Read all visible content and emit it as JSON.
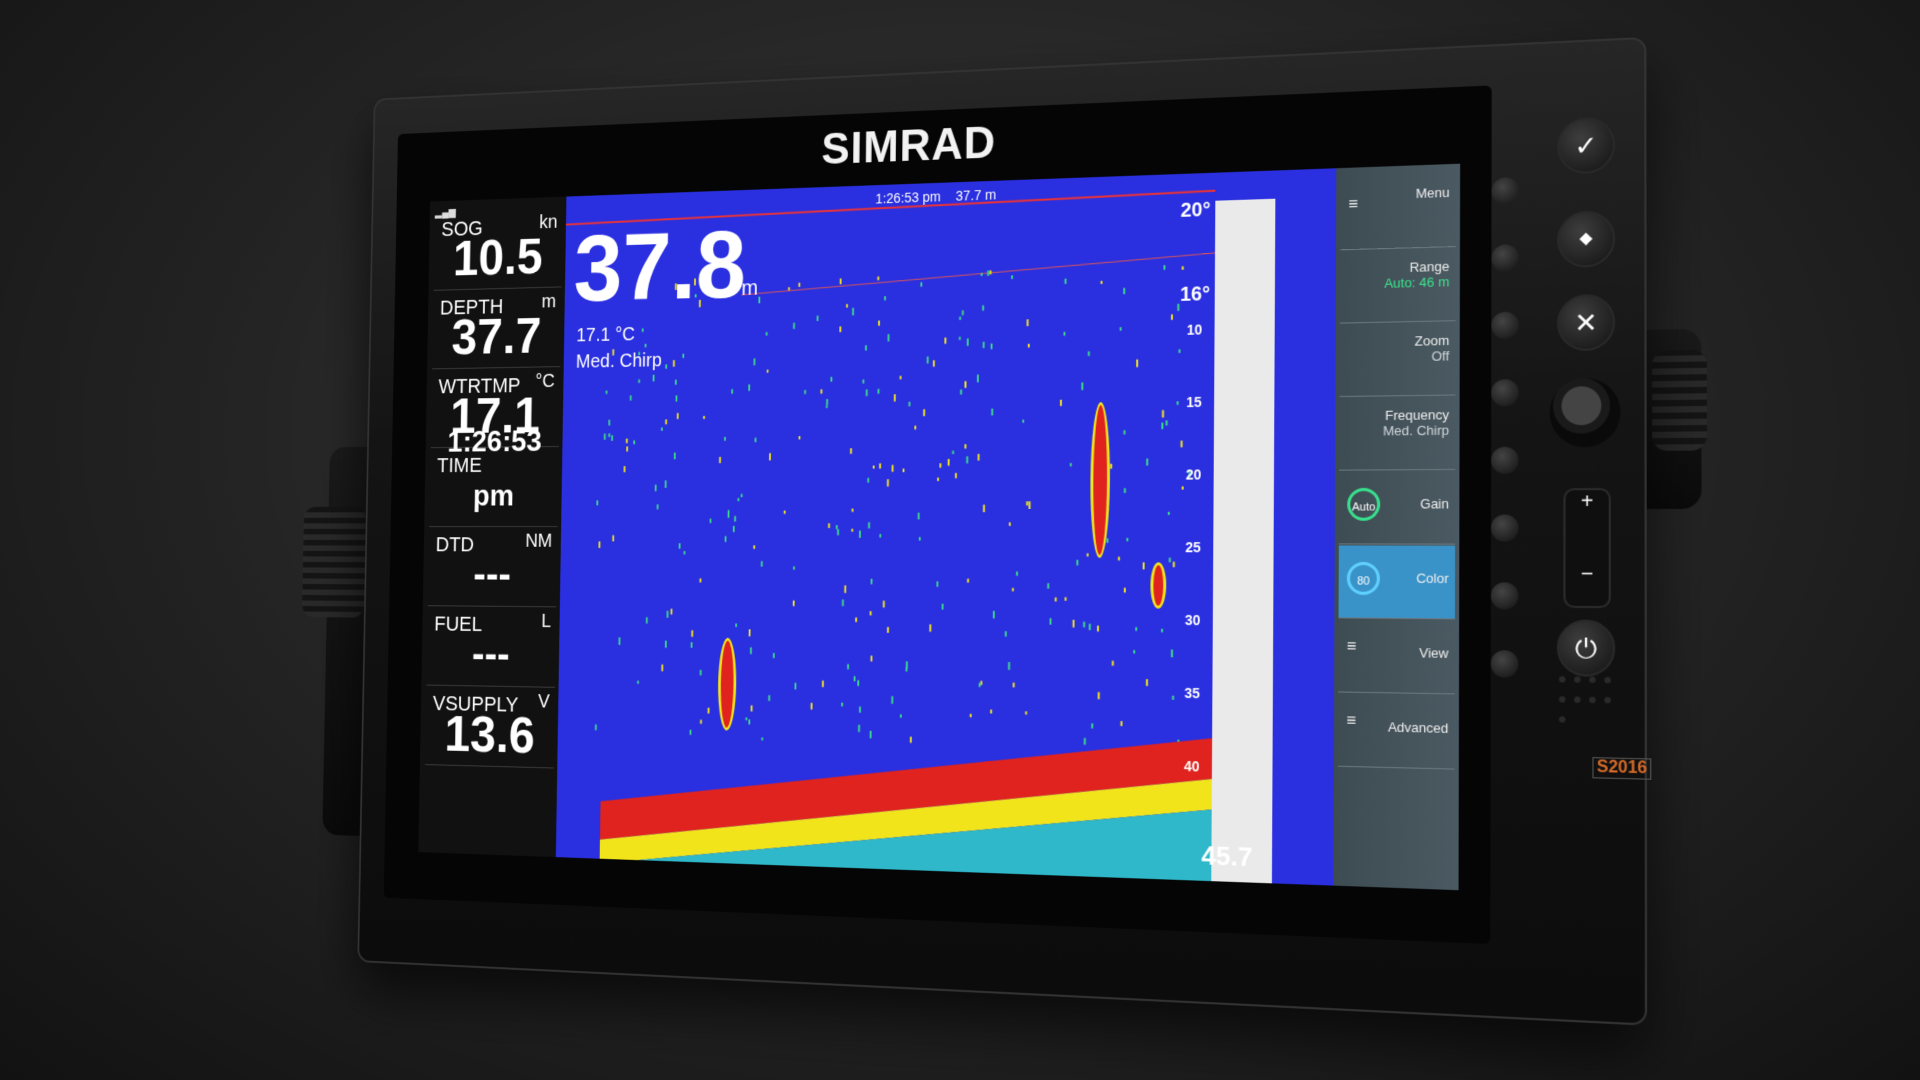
{
  "device": {
    "brand": "SIMRAD",
    "model": "S2016"
  },
  "status": {
    "time": "1:26:53 pm",
    "depth": "37.7 m"
  },
  "panels": [
    {
      "label": "SOG",
      "unit": "kn",
      "value": "10.5"
    },
    {
      "label": "DEPTH",
      "unit": "m",
      "value": "37.7"
    },
    {
      "label": "WTRTMP",
      "unit": "°C",
      "value": "17.1"
    },
    {
      "label": "TIME",
      "unit": "",
      "value": "1:26:53 pm"
    },
    {
      "label": "DTD",
      "unit": "NM",
      "value": "---"
    },
    {
      "label": "FUEL",
      "unit": "L",
      "value": "---"
    },
    {
      "label": "VSUPPLY",
      "unit": "V",
      "value": "13.6"
    }
  ],
  "sonar": {
    "depth_value": "37.8",
    "depth_unit": "m",
    "water_temp": "17.1 °C",
    "frequency": "Med. Chirp",
    "range_top": "20°",
    "range_mid": "16°",
    "range_bottom": "45.7",
    "scale": [
      "10",
      "15",
      "20",
      "25",
      "30",
      "35",
      "40"
    ],
    "colors": {
      "water": "#2a2fe0",
      "strong": "#e0231e",
      "mid": "#f2e41b",
      "weak": "#3ad98a"
    }
  },
  "menu": [
    {
      "label": "Menu",
      "sub": "",
      "icon": "≡"
    },
    {
      "label": "Range",
      "sub": "Auto: 46 m",
      "icon": ""
    },
    {
      "label": "Zoom",
      "sub": "Off",
      "icon": ""
    },
    {
      "label": "Frequency",
      "sub": "Med. Chirp",
      "icon": ""
    },
    {
      "label": "Gain",
      "sub": "",
      "dial": "Auto"
    },
    {
      "label": "Color",
      "sub": "",
      "dial": "80"
    },
    {
      "label": "View",
      "sub": "",
      "icon": "≡"
    },
    {
      "label": "Advanced",
      "sub": "",
      "icon": "≡"
    }
  ],
  "keypad": {
    "ok": "✓",
    "cancel": "✕",
    "plus": "+",
    "minus": "−",
    "power": "⏻"
  }
}
